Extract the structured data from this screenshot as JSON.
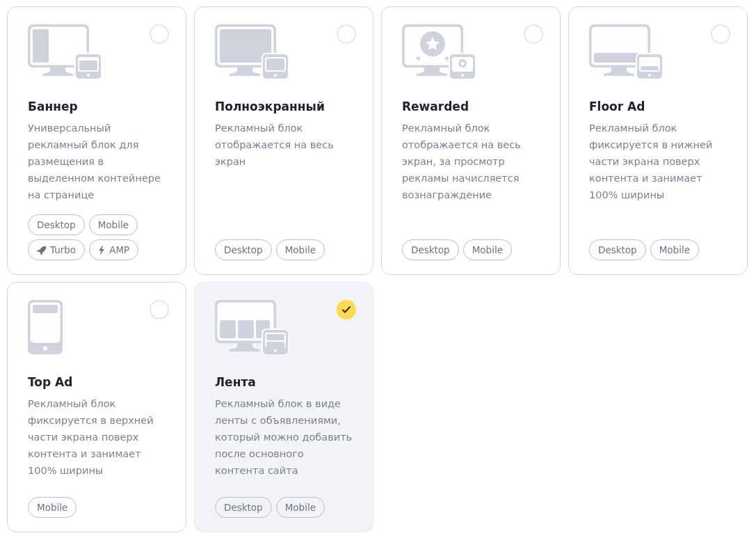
{
  "cards": [
    {
      "kind": "banner",
      "title": "Баннер",
      "description": "Универсальный рекламный блок для размещения в выделенном контейнере на странице",
      "selected": false,
      "tags": [
        {
          "kind": "plain",
          "label": "Desktop"
        },
        {
          "kind": "plain",
          "label": "Mobile"
        },
        {
          "kind": "turbo",
          "label": "Turbo"
        },
        {
          "kind": "amp",
          "label": "AMP"
        }
      ]
    },
    {
      "kind": "fullscreen",
      "title": "Полноэкранный",
      "description": "Рекламный блок отображается на весь экран",
      "selected": false,
      "tags": [
        {
          "kind": "plain",
          "label": "Desktop"
        },
        {
          "kind": "plain",
          "label": "Mobile"
        }
      ]
    },
    {
      "kind": "rewarded",
      "title": "Rewarded",
      "description": "Рекламный блок отображается на весь экран, за просмотр рекламы начисляется вознаграждение",
      "selected": false,
      "tags": [
        {
          "kind": "plain",
          "label": "Desktop"
        },
        {
          "kind": "plain",
          "label": "Mobile"
        }
      ]
    },
    {
      "kind": "floor",
      "title": "Floor Ad",
      "description": "Рекламный блок фиксируется в нижней части экрана поверх контента и занимает 100% ширины",
      "selected": false,
      "tags": [
        {
          "kind": "plain",
          "label": "Desktop"
        },
        {
          "kind": "plain",
          "label": "Mobile"
        }
      ]
    },
    {
      "kind": "top",
      "title": "Top Ad",
      "description": "Рекламный блок фиксируется в верхней части экрана поверх контента и занимает 100% ширины",
      "selected": false,
      "tags": [
        {
          "kind": "plain",
          "label": "Mobile"
        }
      ]
    },
    {
      "kind": "feed",
      "title": "Лента",
      "description": "Рекламный блок в виде ленты с объявлениями, который можно добавить после основного контента сайта",
      "selected": true,
      "tags": [
        {
          "kind": "plain",
          "label": "Desktop"
        },
        {
          "kind": "plain",
          "label": "Mobile"
        }
      ]
    }
  ]
}
